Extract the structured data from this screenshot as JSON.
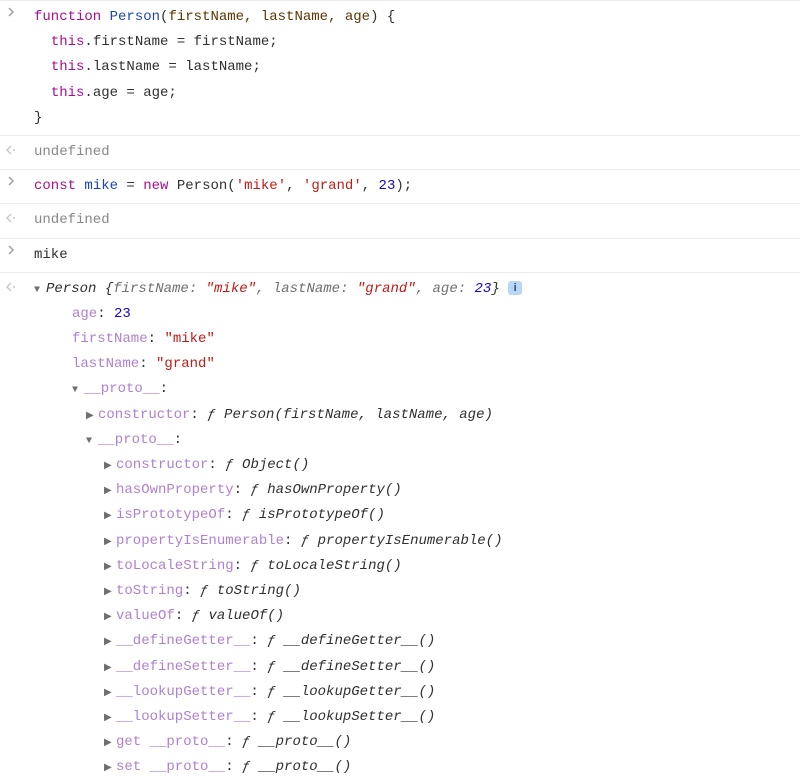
{
  "entry1": {
    "line1_kw": "function",
    "line1_name": " Person",
    "line1_paren_open": "(",
    "line1_params": "firstName, lastName, age",
    "line1_paren_close": ") {",
    "line2a": "this",
    "line2b": ".firstName = firstName;",
    "line3a": "this",
    "line3b": ".lastName = lastName;",
    "line4a": "this",
    "line4b": ".age = age;",
    "line5": "}"
  },
  "result1": "undefined",
  "entry2": {
    "const": "const",
    "var": " mike",
    "eq_new": " = ",
    "new": "new",
    "call": " Person(",
    "arg1": "'mike'",
    "comma1": ", ",
    "arg2": "'grand'",
    "comma2": ", ",
    "arg3": "23",
    "close": ");"
  },
  "result2": "undefined",
  "entry3": "mike",
  "obj": {
    "summary_class": "Person ",
    "summary_open": "{",
    "summary_k1": "firstName: ",
    "summary_v1": "\"mike\"",
    "summary_c1": ", ",
    "summary_k2": "lastName: ",
    "summary_v2": "\"grand\"",
    "summary_c2": ", ",
    "summary_k3": "age: ",
    "summary_v3": "23",
    "summary_close": "}",
    "info": "i",
    "age_k": "age",
    "age_v": "23",
    "fn_k": "firstName",
    "fn_v": "\"mike\"",
    "ln_k": "lastName",
    "ln_v": "\"grand\"",
    "proto": "__proto__",
    "colon": ": ",
    "colon2": ":",
    "ctor_k": "constructor",
    "f": "ƒ ",
    "person_sig": "Person(firstName, lastName, age)",
    "object_sig": "Object()",
    "props": [
      {
        "k": "hasOwnProperty",
        "sig": "hasOwnProperty()"
      },
      {
        "k": "isPrototypeOf",
        "sig": "isPrototypeOf()"
      },
      {
        "k": "propertyIsEnumerable",
        "sig": "propertyIsEnumerable()"
      },
      {
        "k": "toLocaleString",
        "sig": "toLocaleString()"
      },
      {
        "k": "toString",
        "sig": "toString()"
      },
      {
        "k": "valueOf",
        "sig": "valueOf()"
      },
      {
        "k": "__defineGetter__",
        "sig": "__defineGetter__()"
      },
      {
        "k": "__defineSetter__",
        "sig": "__defineSetter__()"
      },
      {
        "k": "__lookupGetter__",
        "sig": "__lookupGetter__()"
      },
      {
        "k": "__lookupSetter__",
        "sig": "__lookupSetter__()"
      }
    ],
    "get_proto_k": "get __proto__",
    "set_proto_k": "set __proto__",
    "proto_sig": "__proto__()"
  }
}
